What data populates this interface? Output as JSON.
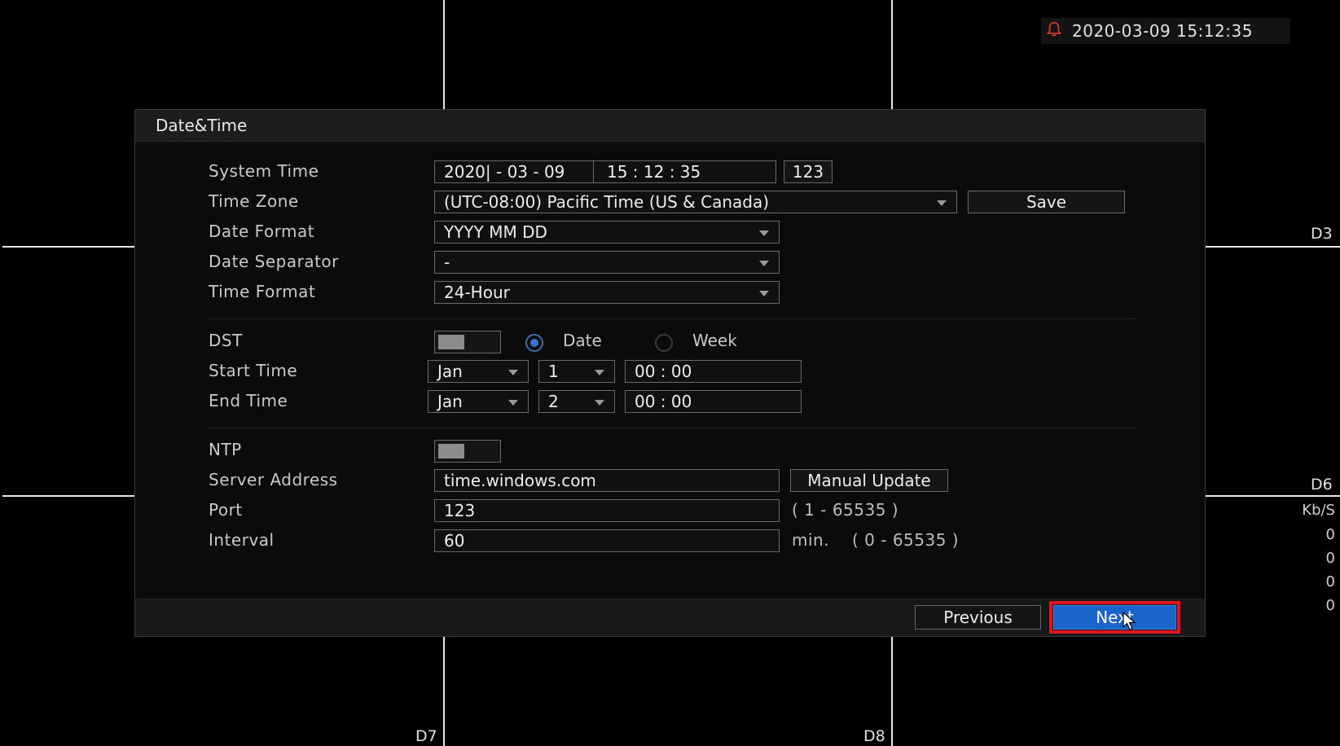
{
  "clock": {
    "datetime": "2020-03-09 15:12:35",
    "icon": "bell-icon",
    "icon_color": "#d23a2a"
  },
  "channels": {
    "d3": "D3",
    "d6": "D6",
    "d7": "D7",
    "d8": "D8"
  },
  "stats": {
    "unit": "Kb/S",
    "values": [
      "0",
      "0",
      "0",
      "0"
    ]
  },
  "dialog": {
    "title": "Date&Time",
    "labels": {
      "system_time": "System Time",
      "time_zone": "Time Zone",
      "date_format": "Date Format",
      "date_separator": "Date Separator",
      "time_format": "Time Format",
      "dst": "DST",
      "start_time": "Start Time",
      "end_time": "End Time",
      "ntp": "NTP",
      "server_address": "Server Address",
      "port": "Port",
      "interval": "Interval"
    },
    "system_time": {
      "date": "2020| - 03 - 09",
      "time": "15 : 12 : 35",
      "keyboard_label": "123"
    },
    "time_zone": {
      "value": "(UTC-08:00) Pacific Time (US & Canada)",
      "save_label": "Save"
    },
    "date_format": {
      "value": "YYYY MM DD"
    },
    "date_separator": {
      "value": "-"
    },
    "time_format": {
      "value": "24-Hour"
    },
    "dst": {
      "enabled": false,
      "mode_options": [
        "Date",
        "Week"
      ],
      "selected_mode": "Date",
      "start": {
        "month": "Jan",
        "day": "1",
        "time": "00 : 00"
      },
      "end": {
        "month": "Jan",
        "day": "2",
        "time": "00 : 00"
      }
    },
    "ntp": {
      "enabled": false,
      "server_address": "time.windows.com",
      "manual_update_label": "Manual Update",
      "port": "123",
      "port_range": "( 1 - 65535 )",
      "interval": "60",
      "interval_unit": "min.",
      "interval_range": "( 0 - 65535 )"
    },
    "footer": {
      "previous_label": "Previous",
      "next_label": "Next"
    }
  },
  "colors": {
    "accent": "#1a63c8",
    "highlight": "#e0141e"
  }
}
